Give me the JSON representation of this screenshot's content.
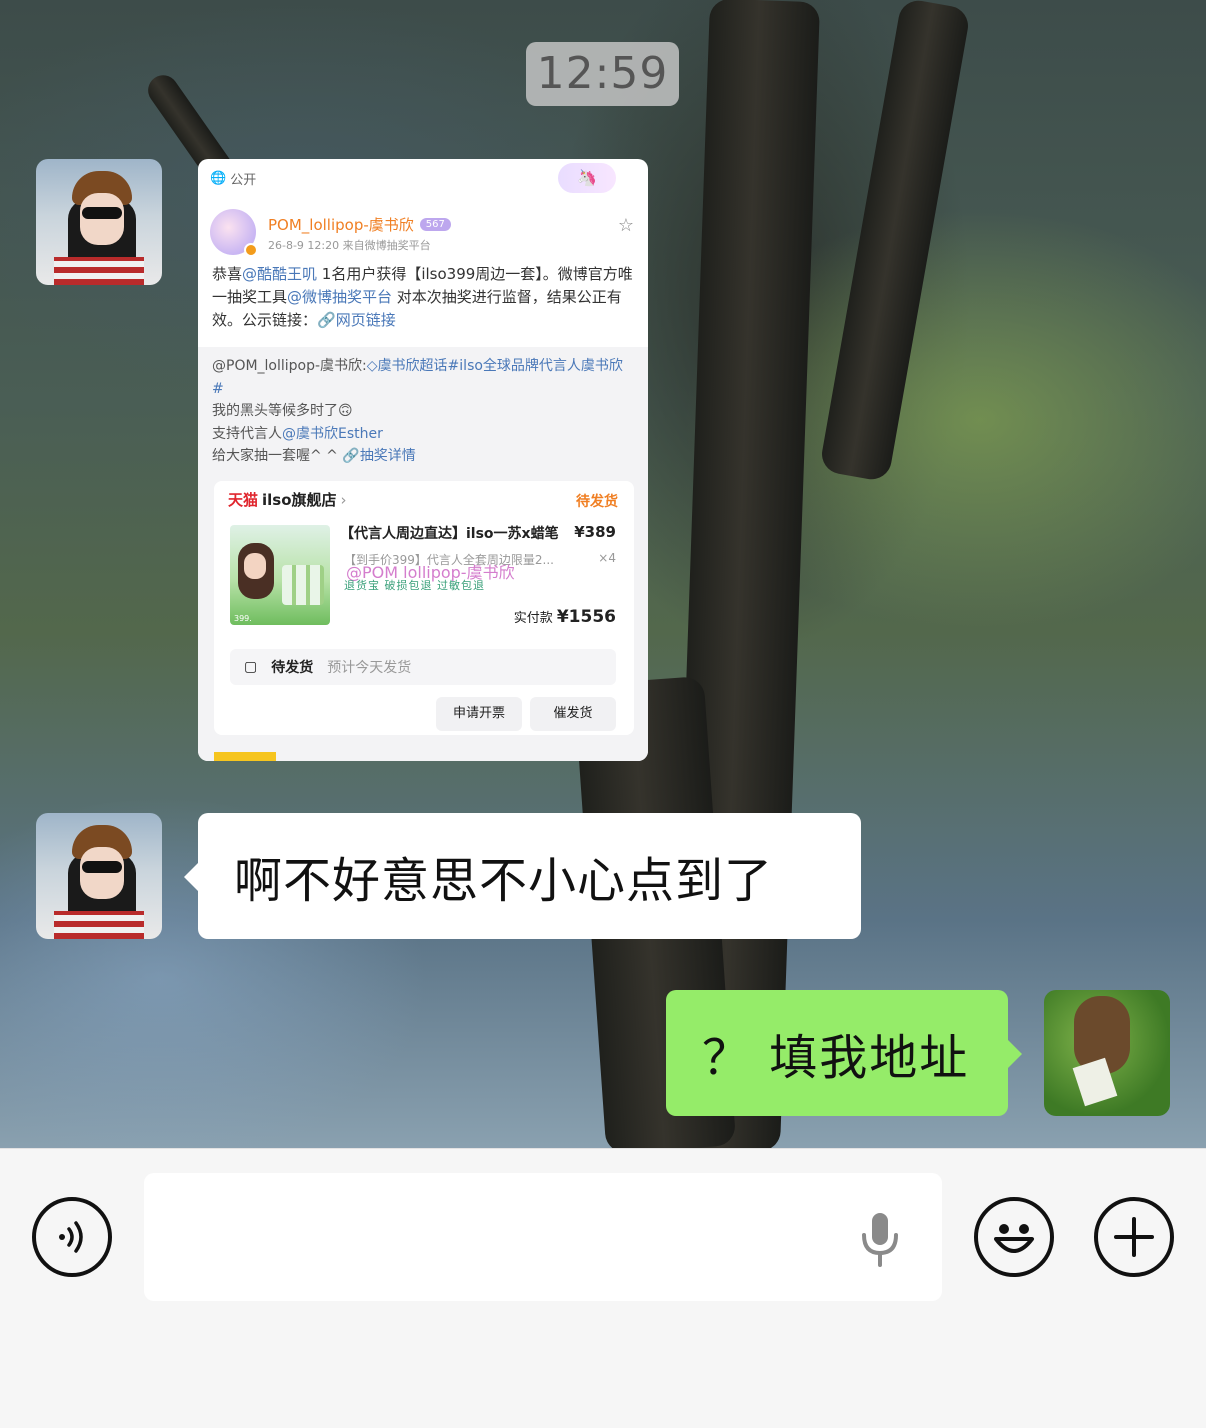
{
  "chat": {
    "time": "12:59",
    "messages": [
      {
        "side": "left",
        "type": "shared-post"
      },
      {
        "side": "left",
        "type": "text",
        "text": "啊不好意思不小心点到了"
      },
      {
        "side": "right",
        "type": "text",
        "text": "？ 填我地址"
      }
    ]
  },
  "post": {
    "visibility": "公开",
    "author": "POM_lollipop-虞书欣",
    "level": "567",
    "meta": "26-8-9 12:20  来自微博抽奖平台",
    "body": {
      "p1": "恭喜",
      "mention_winner": "@酷酷王叽",
      "p2": " 1名用户获得【ilso399周边一套】。微博官方唯一抽奖工具",
      "mention_tool": "@微博抽奖平台",
      "p3": " 对本次抽奖进行监督，结果公正有效。公示链接：",
      "link": "网页链接"
    },
    "repost": {
      "line1": "@POM_lollipop-虞书欣:",
      "topic": "虞书欣超话#ilso全球品牌代言人虞书欣#",
      "line2": "我的黑头等候多时了🙃",
      "line3a": "支持代言人",
      "line3b": "@虞书欣Esther",
      "line4a": "给大家抽一套喔^ ^  ",
      "line4b": "抽奖详情"
    }
  },
  "order": {
    "platform": "天猫",
    "shop": "ilso旗舰店",
    "status": "待发货",
    "title": "【代言人周边直达】ilso一苏x蜡笔",
    "price": "¥389",
    "subtitle": "【到手价399】代言人全套周边限量2...",
    "qty": "×4",
    "watermark": "@POM lollipop-虞书欣",
    "tags": "退货宝  破损包退  过敏包退",
    "paid_label": "实付款",
    "paid_amount": "¥1556",
    "ship_status": "待发货",
    "ship_estimate": "预计今天发货",
    "btn_invoice": "申请开票",
    "btn_urge": "催发货"
  },
  "icons": {
    "voice": "voice-wave-icon",
    "mic": "mic-icon",
    "emoji": "emoji-icon",
    "plus": "plus-icon"
  },
  "colors": {
    "sent_bubble": "#95ec69",
    "received_bubble": "#ffffff",
    "weibo_orange": "#f07f23",
    "link_blue": "#4a78b8"
  }
}
